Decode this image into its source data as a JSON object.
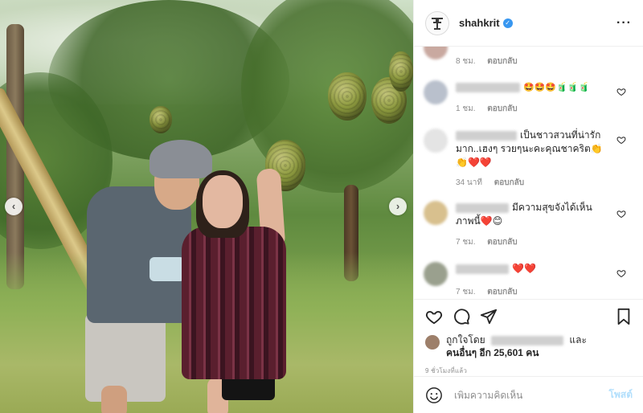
{
  "post": {
    "username": "shahkrit",
    "verified_mark": "✓",
    "more_label": "···"
  },
  "nav": {
    "prev": "‹",
    "next": "›"
  },
  "comments": [
    {
      "text": "",
      "time": "8 ชม.",
      "reply": "ตอบกลับ"
    },
    {
      "text": "🤩🤩🤩🧃🧃🧃",
      "time": "1 ชม.",
      "reply": "ตอบกลับ"
    },
    {
      "text": "เป็นชาวสวนที่น่ารักมาก..เฮงๆ รวยๆนะคะคุณชาคริต👏 👏❤️❤️",
      "time": "34 นาที",
      "reply": "ตอบกลับ"
    },
    {
      "text": "มีความสุขจังได้เห็นภาพนี้❤️😊",
      "time": "7 ชม.",
      "reply": "ตอบกลับ"
    },
    {
      "text": "❤️❤️",
      "time": "7 ชม.",
      "reply": "ตอบกลับ"
    }
  ],
  "likes": {
    "prefix": "ถูกใจโดย",
    "and": "และ",
    "others": "คนอื่นๆ อีก 25,601 คน"
  },
  "timestamp": "9 ชั่วโมงที่แล้ว",
  "add_comment": {
    "placeholder": "เพิ่มความคิดเห็น",
    "post_label": "โพสต์"
  },
  "icons": {
    "like": "heart-icon",
    "comment": "comment-icon",
    "share": "share-icon",
    "save": "bookmark-icon",
    "emoji": "emoji-icon"
  }
}
